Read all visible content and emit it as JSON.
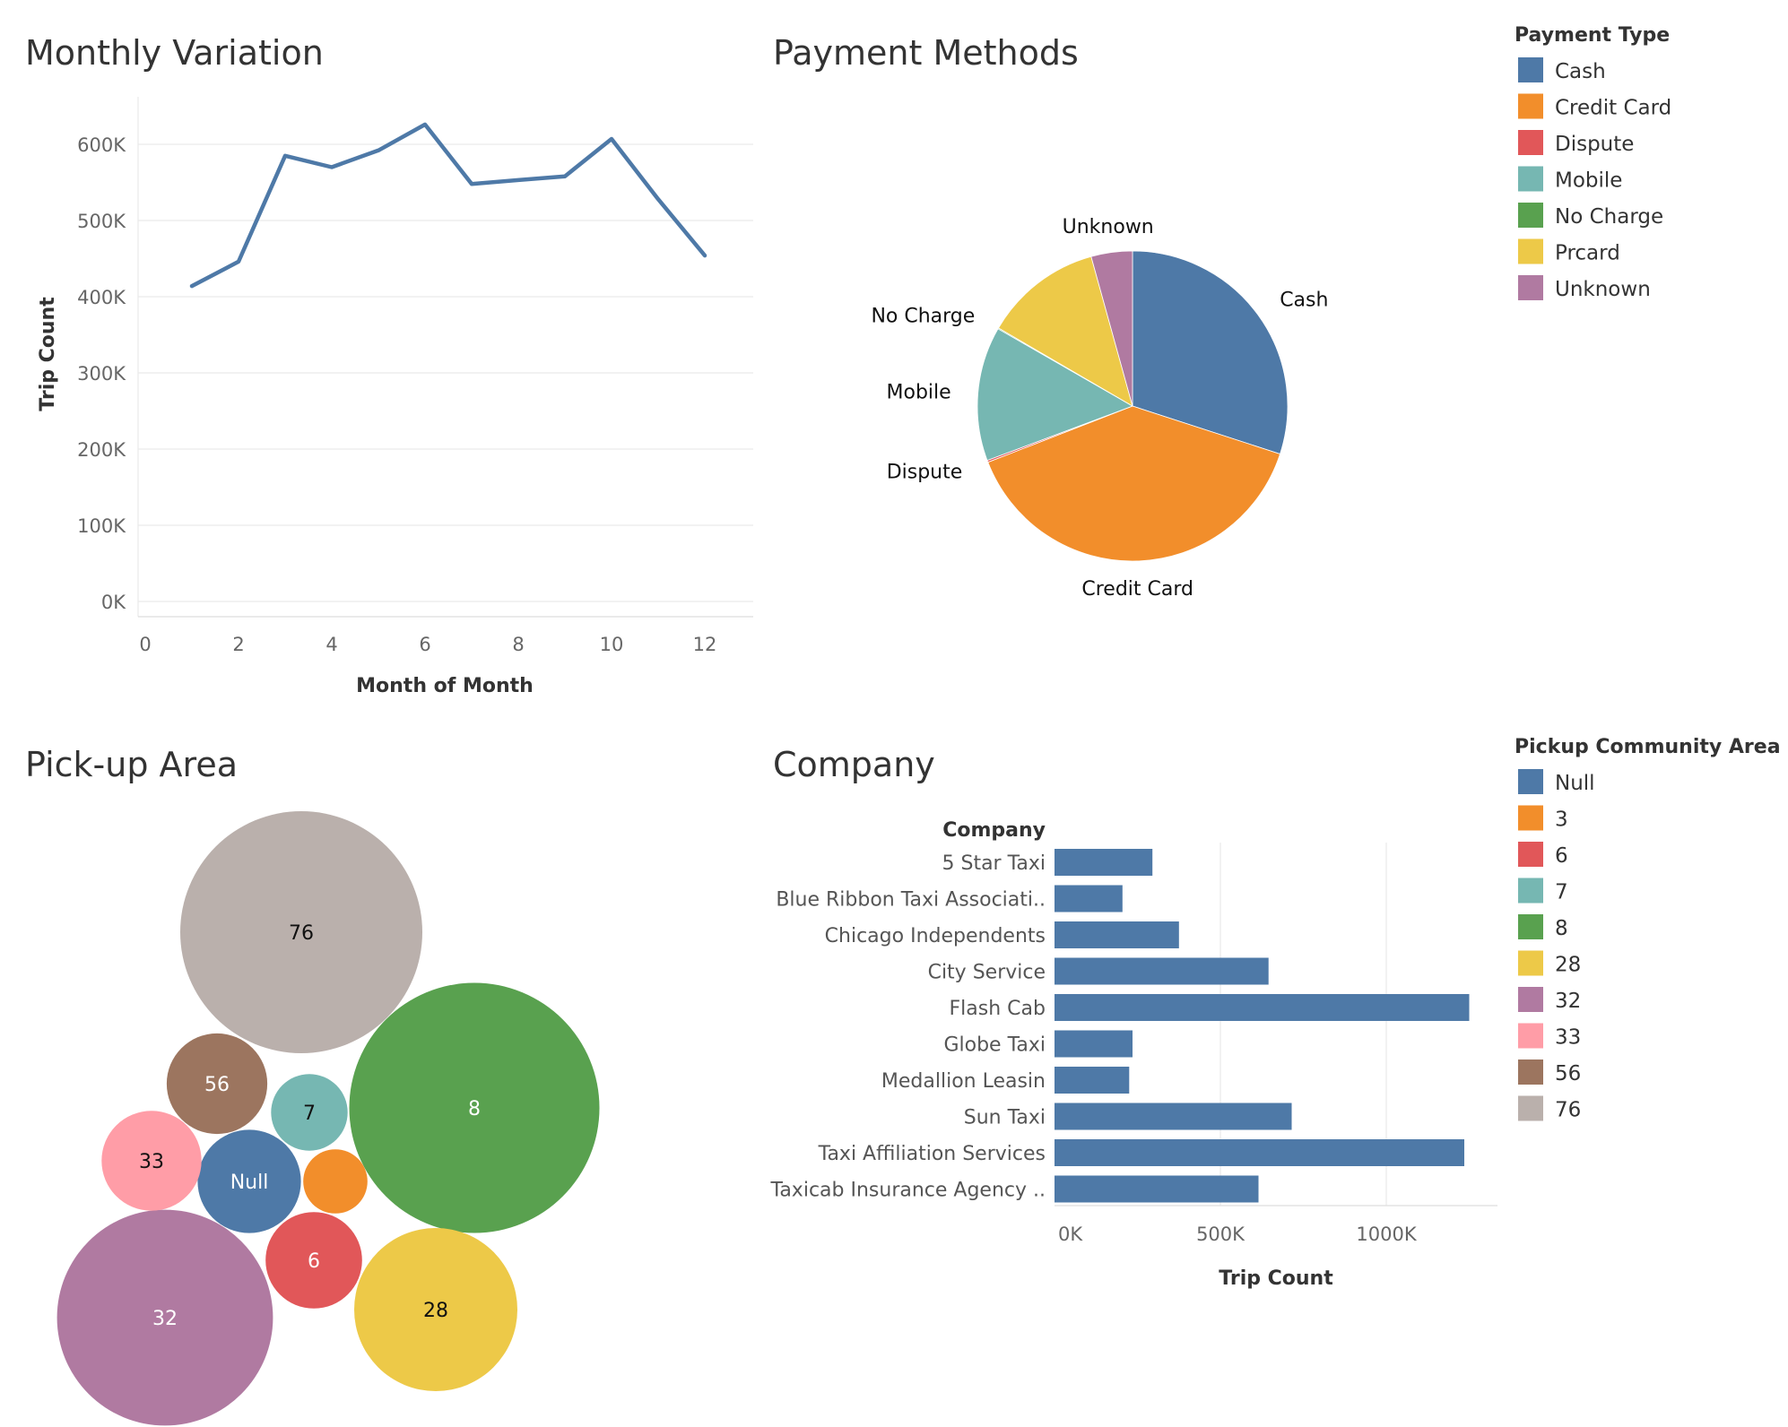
{
  "colors": {
    "Cash": "#4e79a7",
    "Credit Card": "#f28e2b",
    "Dispute": "#e15759",
    "Mobile": "#76b7b2",
    "No Charge": "#59a14f",
    "Prcard": "#edc948",
    "Unknown": "#b07aa1",
    "Null": "#4e79a7",
    "3": "#f28e2b",
    "6": "#e15759",
    "7": "#76b7b2",
    "8": "#59a14f",
    "28": "#edc948",
    "32": "#b07aa1",
    "33": "#ff9da7",
    "56": "#9c755f",
    "76": "#bab0ac"
  },
  "chart_data": [
    {
      "type": "line",
      "title": "Monthly Variation",
      "xlabel": "Month of Month",
      "ylabel": "Trip Count",
      "x": [
        1,
        2,
        3,
        4,
        5,
        6,
        7,
        8,
        9,
        10,
        11,
        12
      ],
      "series": [
        {
          "values": [
            414000,
            446000,
            585000,
            570000,
            592000,
            626000,
            548000,
            553000,
            558000,
            607000,
            528000,
            454000
          ]
        }
      ],
      "xlim": [
        0,
        13
      ],
      "ylim": [
        0,
        650000
      ],
      "xticks": [
        0,
        2,
        4,
        6,
        8,
        10,
        12
      ],
      "yticks": [
        0,
        100000,
        200000,
        300000,
        400000,
        500000,
        600000
      ],
      "ytick_labels": [
        "0K",
        "100K",
        "200K",
        "300K",
        "400K",
        "500K",
        "600K"
      ],
      "grid": true
    },
    {
      "type": "pie",
      "title": "Payment Methods",
      "labels": [
        "Cash",
        "Credit Card",
        "Dispute",
        "Mobile",
        "No Charge",
        "Prcard",
        "Unknown"
      ],
      "values": [
        30.0,
        39.1,
        0.2,
        14.0,
        0.1,
        12.3,
        4.3
      ],
      "slice_labels": [
        "Cash",
        "Credit Card",
        "Dispute",
        "Mobile",
        "No Charge",
        "",
        "Unknown"
      ],
      "legend": {
        "title": "Payment Type",
        "entries": [
          "Cash",
          "Credit Card",
          "Dispute",
          "Mobile",
          "No Charge",
          "Prcard",
          "Unknown"
        ],
        "placement": "right"
      }
    },
    {
      "type": "bubble",
      "title": "Pick-up Area",
      "items": [
        {
          "label": "76",
          "value": 44
        },
        {
          "label": "8",
          "value": 47
        },
        {
          "label": "32",
          "value": 35
        },
        {
          "label": "28",
          "value": 20
        },
        {
          "label": "Null",
          "value": 8
        },
        {
          "label": "56",
          "value": 7.6
        },
        {
          "label": "33",
          "value": 7.5
        },
        {
          "label": "6",
          "value": 7
        },
        {
          "label": "7",
          "value": 4.4
        },
        {
          "label": "3",
          "value": 3.1
        }
      ]
    },
    {
      "type": "bar",
      "orientation": "horizontal",
      "title": "Company",
      "category_header": "Company",
      "categories": [
        "5 Star Taxi",
        "Blue Ribbon Taxi Associati..",
        "Chicago Independents",
        "City Service",
        "Flash Cab",
        "Globe Taxi",
        "Medallion Leasin",
        "Sun Taxi",
        "Taxi Affiliation Services",
        "Taxicab Insurance Agency .."
      ],
      "values": [
        295000,
        205000,
        375000,
        645000,
        1250000,
        235000,
        225000,
        715000,
        1235000,
        615000
      ],
      "xlabel": "Trip Count",
      "xlim": [
        0,
        1350000
      ],
      "xticks": [
        0,
        500000,
        1000000
      ],
      "xtick_labels": [
        "0K",
        "500K",
        "1000K"
      ],
      "legend": {
        "title": "Pickup Community Area",
        "entries": [
          "Null",
          "3",
          "6",
          "7",
          "8",
          "28",
          "32",
          "33",
          "56",
          "76"
        ],
        "placement": "right"
      }
    }
  ]
}
